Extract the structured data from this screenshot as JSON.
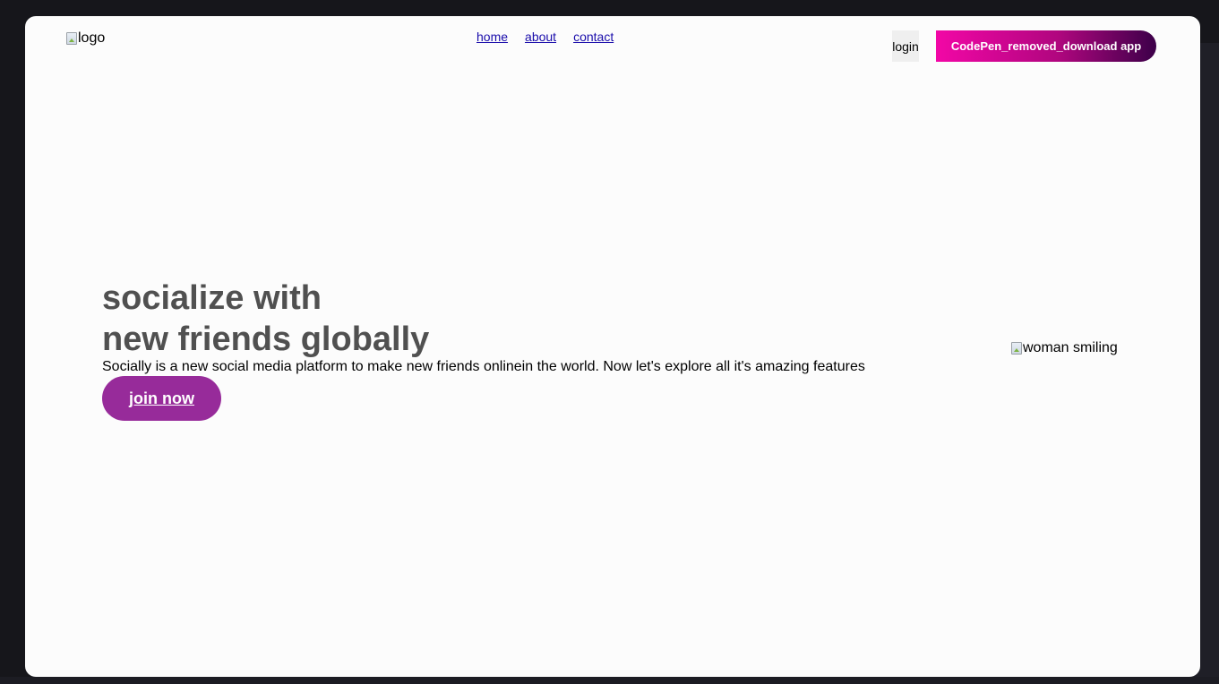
{
  "header": {
    "logo_alt": "logo",
    "nav": {
      "home": "home",
      "about": "about",
      "contact": "contact"
    },
    "login_label": "login",
    "download_label": "CodePen_removed_download app"
  },
  "hero": {
    "title_line1": "socialize with",
    "title_line2": "new friends globally",
    "description": "Socially is a new social media platform to make new friends onlinein the world. Now let's explore all it's amazing features",
    "cta_label": "join now",
    "image_alt": "woman smiling"
  },
  "colors": {
    "page_background": "#fcfcfc",
    "backdrop": "#16161b",
    "title_text": "#505050",
    "link": "#1a0dab",
    "cta_background": "#972b9a",
    "download_gradient_start": "#f207a6",
    "download_gradient_end": "#3c0049"
  },
  "icons": {
    "broken_image": "broken-image-icon"
  }
}
